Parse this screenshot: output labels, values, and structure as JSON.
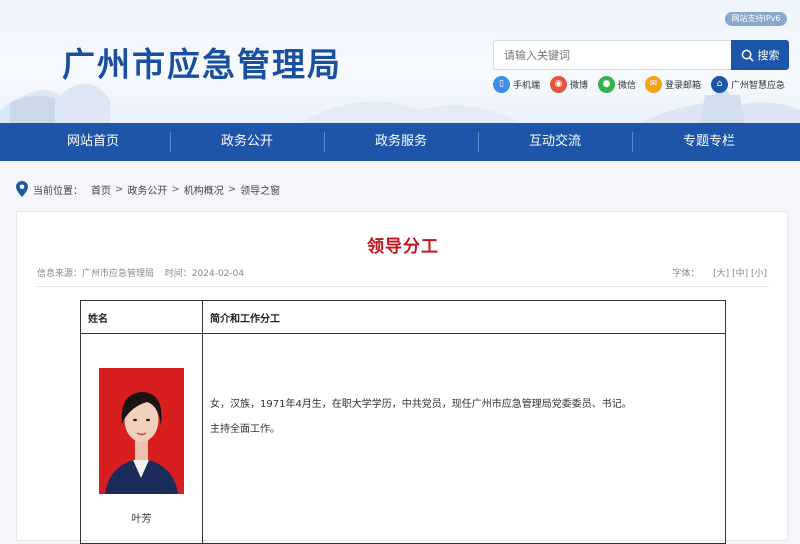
{
  "header": {
    "site_title": "广州市应急管理局",
    "ipv6_badge": "网站支持IPv6",
    "search": {
      "placeholder": "请输入关键词",
      "button_label": "搜索"
    },
    "quick_links": [
      {
        "label": "手机端",
        "icon": "mobile-icon",
        "color": "#3a8ee6"
      },
      {
        "label": "微博",
        "icon": "weibo-icon",
        "color": "#e6543b"
      },
      {
        "label": "微信",
        "icon": "wechat-icon",
        "color": "#34b24a"
      },
      {
        "label": "登录邮箱",
        "icon": "mail-icon",
        "color": "#f2a318"
      },
      {
        "label": "广州智慧应急",
        "icon": "emergency-app-icon",
        "color": "#1d56a8"
      }
    ]
  },
  "nav": {
    "items": [
      "网站首页",
      "政务公开",
      "政务服务",
      "互动交流",
      "专题专栏"
    ],
    "color": "#1d56a8"
  },
  "breadcrumb": {
    "label": "当前位置：",
    "items": [
      "首页",
      "政务公开",
      "机构概况",
      "领导之窗"
    ],
    "separator": ">"
  },
  "article": {
    "title": "领导分工",
    "source_label": "信息来源：",
    "source": "广州市应急管理局",
    "time_label": "时间：",
    "time": "2024-02-04",
    "font_label": "字体：",
    "font_sizes": [
      "[大]",
      "[中]",
      "[小]"
    ],
    "title_color": "#c4151c"
  },
  "table": {
    "headers": [
      "姓名",
      "简介和工作分工"
    ],
    "rows": [
      {
        "name": "叶芳",
        "bio": "女，汉族，1971年4月生，在职大学学历，中共党员，现任广州市应急管理局党委委员、书记。",
        "duty": "主持全面工作。"
      }
    ]
  }
}
